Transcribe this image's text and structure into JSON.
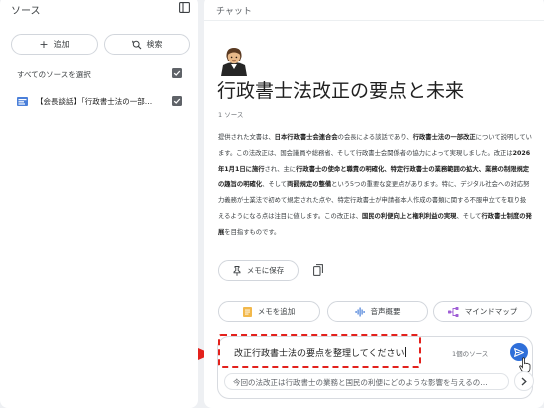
{
  "sources_panel": {
    "title": "ソース",
    "add_label": "追加",
    "search_label": "検索",
    "select_all_label": "すべてのソースを選択",
    "source_item": "【会長談話】「行政書士法の一部…"
  },
  "chat_panel": {
    "title": "チャット",
    "note_title": "行政書士法改正の要点と未来",
    "source_count": "1 ソース",
    "summary": {
      "p1": "提供された文書は、",
      "b1": "日本行政書士会連合会",
      "p2": "の会長による談話であり、",
      "b2": "行政書士法の一部改正",
      "p3": "について説明しています。この法改正は、国会議員や総務省、そして行政書士会関係者の協力によって実現しました。改正は",
      "b3": "2026年1月1日に施行",
      "p4": "され、主に",
      "b4": "行政書士の使命と職責の明確化、特定行政書士の業務範囲の拡大、業務の制限規定の趣旨の明確化",
      "p5": "、そして",
      "b5": "両罰規定の整備",
      "p6": "という5つの重要な変更点があります。特に、デジタル社会への対応努力義務が士業法で初めて規定された点や、特定行政書士が申請者本人作成の書類に関する不服申立てを取り扱えるようになる点は注目に値します。この改正は、",
      "b6": "国民の利便向上と権利利益の実現",
      "p7": "、そして",
      "b7": "行政書士制度の発展",
      "p8": "を目指すものです。"
    },
    "save_to_note_label": "メモに保存",
    "actions": {
      "memo_label": "メモを追加",
      "audio_label": "音声概要",
      "mindmap_label": "マインドマップ"
    },
    "input_value": "改正行政書士法の要点を整理してください",
    "input_source_count": "1個のソース",
    "suggestion": "今回の法改正は行政書士の業務と国民の利便にどのような影響を与えるの…"
  },
  "colors": {
    "highlight": "#e3211c",
    "send_button": "#2f6fd9",
    "icon_gray": "#5f6368"
  }
}
